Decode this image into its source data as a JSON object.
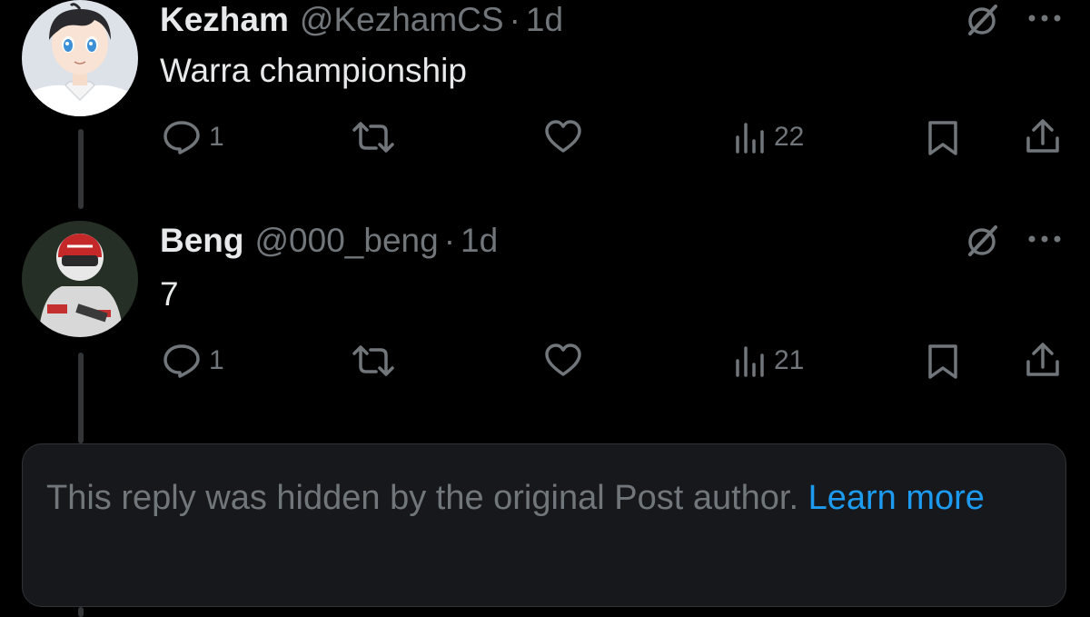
{
  "posts": [
    {
      "display_name": "Kezham",
      "handle": "@KezhamCS",
      "dot": "·",
      "time": "1d",
      "text": "Warra championship",
      "reply_count": "1",
      "repost_count": "",
      "like_count": "",
      "views_count": "22",
      "avatar_icon": "anime-boy-avatar",
      "grok_icon": "grok-icon",
      "more_icon": "more-dots-icon"
    },
    {
      "display_name": "Beng",
      "handle": "@000_beng",
      "dot": "·",
      "time": "1d",
      "text": "7",
      "reply_count": "1",
      "repost_count": "",
      "like_count": "",
      "views_count": "21",
      "avatar_icon": "racing-driver-avatar",
      "grok_icon": "grok-icon",
      "more_icon": "more-dots-icon"
    }
  ],
  "hidden_notice": {
    "text": "This reply was hidden by the original Post author. ",
    "link": "Learn more"
  },
  "colors": {
    "background": "#000000",
    "primary_text": "#e7e9ea",
    "secondary_text": "#71767b",
    "link": "#1d9bf0",
    "notice_bg": "#16181c",
    "thread_line": "#333639"
  }
}
